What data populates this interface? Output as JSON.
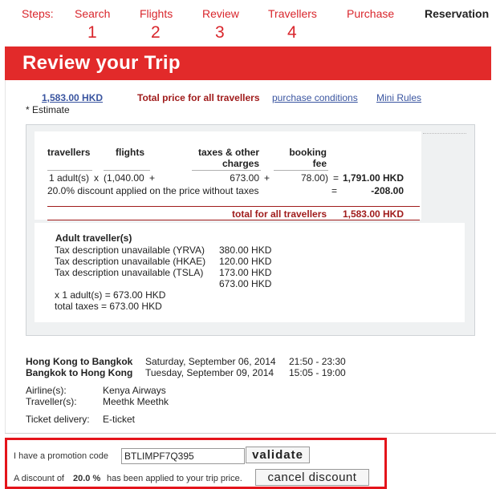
{
  "steps": {
    "label": "Steps:",
    "items": [
      {
        "label": "Search",
        "number": "1"
      },
      {
        "label": "Flights",
        "number": "2"
      },
      {
        "label": "Review",
        "number": "3"
      },
      {
        "label": "Travellers",
        "number": "4"
      },
      {
        "label": "Purchase",
        "number": ""
      }
    ],
    "current": "Reservation"
  },
  "banner": {
    "title": "Review your Trip"
  },
  "price": {
    "amount": "1,583.00 HKD",
    "estimate": "* Estimate",
    "total_label": "Total price for all travellers",
    "purchase_conditions": "purchase conditions",
    "mini_rules": "Mini Rules"
  },
  "breakdown": {
    "headers": {
      "travellers": "travellers",
      "flights": "flights",
      "taxes": "taxes & other",
      "taxes2": "charges",
      "fee": "booking",
      "fee2": "fee"
    },
    "row": {
      "travellers": "1 adult(s)",
      "times": "x",
      "flights": "(1,040.00",
      "plus1": "+",
      "taxes": "673.00",
      "plus2": "+",
      "fee": "78.00)",
      "eq": "=",
      "total": "1,791.00 HKD"
    },
    "discount": {
      "label": "20.0% discount applied on the price without taxes",
      "eq": "=",
      "value": "-208.00"
    },
    "grand_total": {
      "label": "total for all travellers",
      "value": "1,583.00 HKD"
    }
  },
  "taxes": {
    "title": "Adult traveller(s)",
    "lines": [
      {
        "desc": "Tax description unavailable (YRVA)",
        "value": "380.00 HKD"
      },
      {
        "desc": "Tax description unavailable (HKAE)",
        "value": "120.00 HKD"
      },
      {
        "desc": "Tax description unavailable (TSLA)",
        "value": "173.00 HKD"
      }
    ],
    "subtotal": "673.00 HKD",
    "per_adult": "x 1 adult(s) = 673.00 HKD",
    "total": "total taxes = 673.00 HKD"
  },
  "itinerary": [
    {
      "route": "Hong Kong to Bangkok",
      "date": "Saturday, September 06, 2014",
      "time": "21:50 - 23:30"
    },
    {
      "route": "Bangkok to Hong Kong",
      "date": "Tuesday, September 09, 2014",
      "time": "15:05 - 19:00"
    }
  ],
  "details": {
    "airline_label": "Airline(s):",
    "airline": "Kenya Airways",
    "traveller_label": "Traveller(s):",
    "traveller": "Meethk Meethk",
    "delivery_label": "Ticket delivery:",
    "delivery": "E-ticket"
  },
  "promo": {
    "label": "I have a promotion code",
    "code": "BTLIMPF7Q395",
    "validate": "validate",
    "applied_pre": "A discount of",
    "applied_pct": "20.0 %",
    "applied_post": "has been applied to your trip price.",
    "cancel": "cancel discount"
  },
  "colors": {
    "accent": "#e22a2a",
    "link": "#3a55a0",
    "total_label": "#a01c1c",
    "promo_border": "#e4141b"
  }
}
